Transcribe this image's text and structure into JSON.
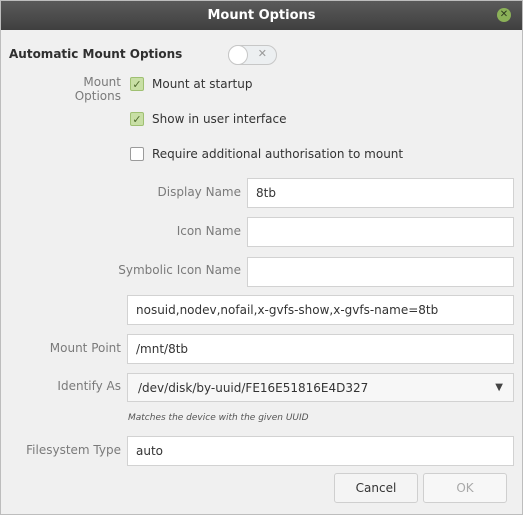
{
  "window": {
    "title": "Mount Options"
  },
  "auto_mount": {
    "title": "Automatic Mount Options",
    "switch_on": false
  },
  "mount_options": {
    "label": "Mount Options",
    "checkboxes": [
      {
        "label": "Mount at startup",
        "checked": true
      },
      {
        "label": "Show in user interface",
        "checked": true
      },
      {
        "label": "Require additional authorisation to mount",
        "checked": false
      }
    ]
  },
  "fields": {
    "display_name": {
      "label": "Display Name",
      "value": "8tb"
    },
    "icon_name": {
      "label": "Icon Name",
      "value": ""
    },
    "symbolic_icon_name": {
      "label": "Symbolic Icon Name",
      "value": ""
    },
    "options_string": {
      "value": "nosuid,nodev,nofail,x-gvfs-show,x-gvfs-name=8tb"
    },
    "mount_point": {
      "label": "Mount Point",
      "value": "/mnt/8tb"
    },
    "identify_as": {
      "label": "Identify As",
      "value": "/dev/disk/by-uuid/FE16E51816E4D327",
      "hint": "Matches the device with the given UUID"
    },
    "filesystem_type": {
      "label": "Filesystem Type",
      "value": "auto"
    }
  },
  "buttons": {
    "cancel": "Cancel",
    "ok": "OK"
  },
  "icons": {
    "close": "close-icon",
    "switch_off": "x-icon",
    "checkmark": "check-icon",
    "dropdown": "chevron-down-icon"
  }
}
